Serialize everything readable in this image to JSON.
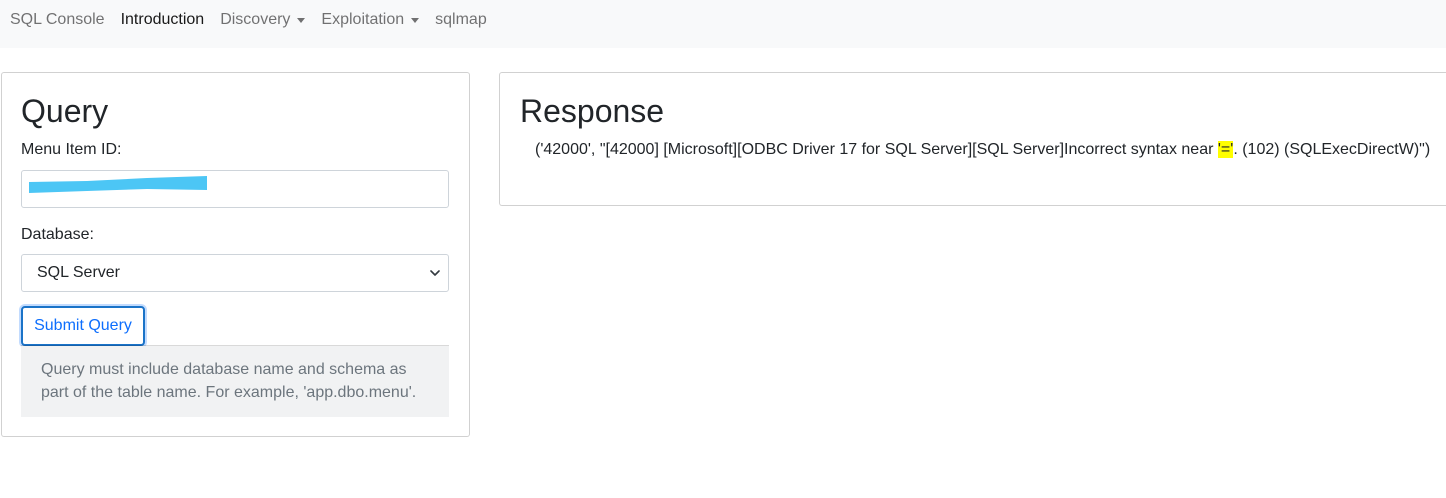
{
  "navbar": {
    "items": [
      {
        "label": "SQL Console",
        "active": false,
        "dropdown": false
      },
      {
        "label": "Introduction",
        "active": true,
        "dropdown": false
      },
      {
        "label": "Discovery",
        "active": false,
        "dropdown": true
      },
      {
        "label": "Exploitation",
        "active": false,
        "dropdown": true
      },
      {
        "label": "sqlmap",
        "active": false,
        "dropdown": false
      }
    ]
  },
  "query": {
    "title": "Query",
    "menu_item_label": "Menu Item ID:",
    "menu_item_value": "",
    "redaction_color": "#4cc6f5",
    "database_label": "Database:",
    "database_selected": "SQL Server",
    "submit_label": "Submit Query",
    "note": "Query must include database name and schema as part of the table name. For example, 'app.dbo.menu'."
  },
  "response": {
    "title": "Response",
    "text_before": "('42000', \"[42000] [Microsoft][ODBC Driver 17 for SQL Server][SQL Server]Incorrect syntax near ",
    "highlight": "'='",
    "text_after": ". (102) (SQLExecDirectW)\")",
    "highlight_color": "#ffff00"
  },
  "colors": {
    "navbar_bg": "#f8f9fa",
    "primary": "#0d6efd"
  }
}
